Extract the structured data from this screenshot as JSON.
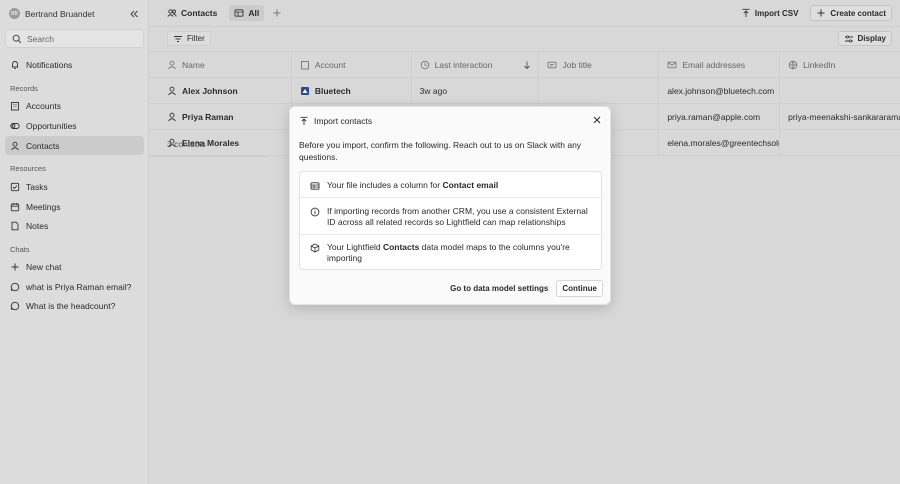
{
  "user": {
    "initials": "BB",
    "name": "Bertrand Bruandet"
  },
  "search": {
    "label": "Search"
  },
  "sidebar": {
    "notifications": "Notifications",
    "records_heading": "Records",
    "records": [
      "Accounts",
      "Opportunities",
      "Contacts"
    ],
    "resources_heading": "Resources",
    "resources": [
      "Tasks",
      "Meetings",
      "Notes"
    ],
    "chats_heading": "Chats",
    "new_chat": "New chat",
    "chats": [
      "what is Priya Raman email?",
      "What is the headcount?"
    ]
  },
  "topbar": {
    "tab_contacts": "Contacts",
    "tab_all": "All",
    "import_csv": "Import CSV",
    "create_contact": "Create contact"
  },
  "toolbar": {
    "filter": "Filter",
    "display": "Display"
  },
  "table": {
    "headers": [
      "Name",
      "Account",
      "Last interaction",
      "Job title",
      "Email addresses",
      "LinkedIn"
    ],
    "rows": [
      {
        "name": "Alex Johnson",
        "account": "Bluetech",
        "last": "3w ago",
        "job": "",
        "email": "alex.johnson@bluetech.com",
        "linkedin": ""
      },
      {
        "name": "Priya Raman",
        "account": "",
        "last": "",
        "job": "",
        "email": "priya.raman@apple.com",
        "linkedin": "priya-meenakshi-sankararaman"
      },
      {
        "name": "Elena Morales",
        "account": "",
        "last": "",
        "job": "",
        "email": "elena.morales@greentechsolutions.com",
        "linkedin": ""
      }
    ],
    "count": "3 contacts"
  },
  "modal": {
    "title": "Import contacts",
    "intro": "Before you import, confirm the following. Reach out to us on Slack with any questions.",
    "item1_pre": "Your file includes a column for ",
    "item1_bold": "Contact email",
    "item2": "If importing records from another CRM, you use a consistent External ID across all related records so Lightfield can map relationships",
    "item3_pre": "Your Lightfield ",
    "item3_bold": "Contacts",
    "item3_post": " data model maps to the columns you're importing",
    "link": "Go to data model settings",
    "continue": "Continue"
  }
}
